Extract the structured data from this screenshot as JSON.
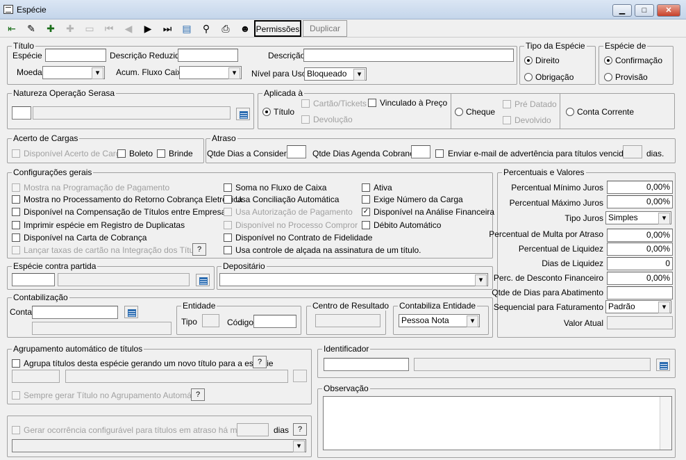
{
  "window": {
    "title": "Espécie",
    "min": "▁",
    "max": "□",
    "close": "✕"
  },
  "toolbar": {
    "permissoes": "Permissões",
    "duplicar": "Duplicar"
  },
  "titulo": {
    "legend": "Título",
    "especie_label": "Espécie",
    "especie_value": "",
    "desc_red_label": "Descrição Reduzida",
    "desc_red_value": "",
    "descricao_label": "Descrição",
    "descricao_value": "",
    "moeda_label": "Moeda",
    "moeda_value": "",
    "acum_label": "Acum. Fluxo Caixa",
    "acum_value": "",
    "nivel_label": "Nível para Uso",
    "nivel_value": "Bloqueado"
  },
  "tipo_especie": {
    "legend": "Tipo da Espécie",
    "direito": "Direito",
    "obrigacao": "Obrigação"
  },
  "especie_de": {
    "legend": "Espécie de",
    "confirmacao": "Confirmação",
    "provisao": "Provisão"
  },
  "natureza": {
    "legend": "Natureza Operação Serasa"
  },
  "aplicada": {
    "legend": "Aplicada à",
    "titulo": "Título",
    "cartao": "Cartão/Tickets",
    "vinculado": "Vinculado à Preço",
    "devolucao": "Devolução",
    "cheque": "Cheque",
    "pre_datado": "Pré Datado",
    "devolvido": "Devolvido",
    "conta_corrente": "Conta Corrente"
  },
  "acerto": {
    "legend": "Acerto de Cargas",
    "disponivel": "Disponível Acerto de Carga",
    "boleto": "Boleto",
    "brinde": "Brinde"
  },
  "atraso": {
    "legend": "Atraso",
    "qtde_dias": "Qtde Dias a Considerar",
    "qtde_agenda": "Qtde Dias Agenda Cobrança",
    "enviar": "Enviar e-mail de advertência para títulos vencidos à",
    "dias": "dias."
  },
  "config": {
    "legend": "Configurações gerais",
    "col1": [
      "Mostra na Programação de Pagamento",
      "Mostra no Processamento do Retorno Cobrança Eletrônica",
      "Disponível na Compensação de Títulos entre Empresas",
      "Imprimir espécie em Registro de Duplicatas",
      "Disponível na Carta de Cobrança",
      "Lançar taxas de cartão na Integração dos Títulos"
    ],
    "col2": [
      "Soma no Fluxo de Caixa",
      "Usa Conciliação Automática",
      "Usa Autorização de Pagamento",
      "Disponível no Processo Compror",
      "Disponível no Contrato de Fidelidade",
      "Usa controle de alçada na assinatura de um título."
    ],
    "col3": [
      "Ativa",
      "Exige Número da Carga",
      "Disponível na Análise Financeira",
      "Débito Automático"
    ],
    "help": "?"
  },
  "percentuais": {
    "legend": "Percentuais e Valores",
    "rows": [
      {
        "label": "Percentual Mínimo Juros",
        "value": "0,00%"
      },
      {
        "label": "Percentual Máximo Juros",
        "value": "0,00%"
      },
      {
        "label": "Tipo Juros",
        "value": "Simples"
      },
      {
        "label": "Percentual de Multa por Atraso",
        "value": "0,00%"
      },
      {
        "label": "Percentual de Liquidez",
        "value": "0,00%"
      },
      {
        "label": "Dias de Liquidez",
        "value": "0"
      },
      {
        "label": "Perc. de Desconto Financeiro",
        "value": "0,00%"
      },
      {
        "label": "Qtde de Dias para Abatimento",
        "value": ""
      },
      {
        "label": "Sequencial para Faturamento",
        "value": "Padrão"
      },
      {
        "label": "Valor Atual",
        "value": ""
      }
    ]
  },
  "contra": {
    "legend": "Espécie contra partida"
  },
  "depositario": {
    "legend": "Depositário"
  },
  "contab": {
    "legend": "Contabilização",
    "conta": "Conta",
    "entidade": "Entidade",
    "tipo": "Tipo",
    "codigo": "Código",
    "centro": "Centro de Resultado",
    "contabiliza": "Contabiliza Entidade",
    "contabiliza_value": "Pessoa Nota"
  },
  "agrup": {
    "legend": "Agrupamento automático de títulos",
    "agrupa": "Agrupa títulos desta espécie gerando um novo título para a espécie",
    "sempre": "Sempre gerar Título no  Agrupamento Automático"
  },
  "identificador": {
    "legend": "Identificador"
  },
  "observacao": {
    "legend": "Observação"
  },
  "ocorrencia": {
    "text": "Gerar ocorrência configurável para títulos em atraso há mais de",
    "dias": "dias"
  }
}
